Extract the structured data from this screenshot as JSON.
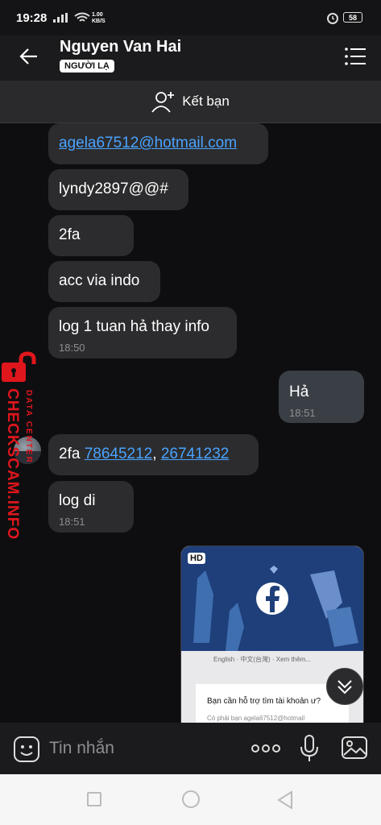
{
  "status_bar": {
    "time": "19:28",
    "speed": "1.00",
    "speed_unit": "KB/S",
    "battery": "58"
  },
  "header": {
    "contact_name": "Nguyen Van Hai",
    "badge": "NGƯỜI LẠ"
  },
  "add_friend": {
    "label": "Kết bạn"
  },
  "messages": [
    {
      "text": "agela67512@hotmail.com"
    },
    {
      "text": "lyndy2897@@#"
    },
    {
      "text": "2fa"
    },
    {
      "text": "acc via indo"
    },
    {
      "text": "log 1 tuan hả thay info",
      "time": "18:50"
    },
    {
      "text": "Hả",
      "time": "18:51"
    },
    {
      "prefix": "2fa ",
      "link1": "78645212",
      "sep": ", ",
      "link2": "26741232"
    },
    {
      "text": "log di",
      "time": "18:51"
    }
  ],
  "image_message": {
    "hd_badge": "HD",
    "lang_line": "English · 中文(台灣) · Xem thêm...",
    "dialog_title": "Bạn cần hỗ trợ tìm tài khoản ư?",
    "dialog_sub": "Có phải bạn agela67512@hotmail"
  },
  "watermark": {
    "line1": "DATA CENTER",
    "line2": "CHECKSCAM.INFO"
  },
  "composer": {
    "placeholder": "Tin nhắn"
  },
  "colors": {
    "link": "#4aa3ff",
    "bubble": "#2c2c2e",
    "mine_bubble": "#3a3f46",
    "watermark_red": "#e0161d"
  }
}
